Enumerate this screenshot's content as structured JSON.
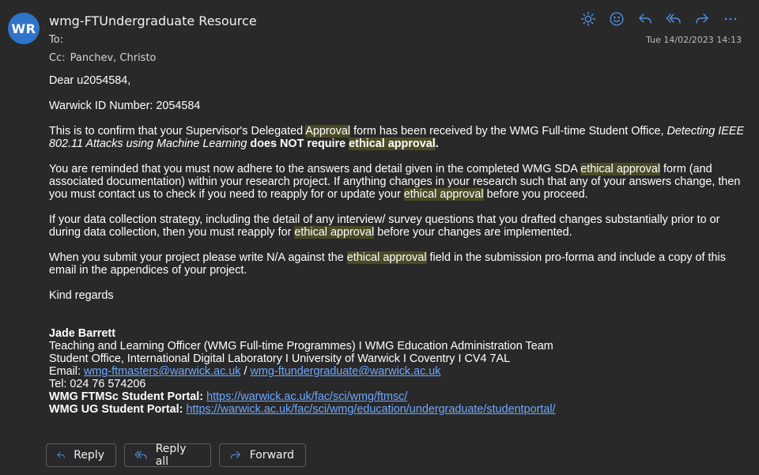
{
  "header": {
    "avatar_initials": "WR",
    "sender_name": "wmg-FTUndergraduate Resource",
    "to_label": "To:",
    "cc_label": "Cc:",
    "cc_name": "Panchev, Christo",
    "timestamp": "Tue 14/02/2023 14:13"
  },
  "toolbar": {
    "icons": [
      "brightness-icon",
      "emoji-icon",
      "reply-icon",
      "reply-all-icon",
      "forward-icon",
      "more-icon"
    ],
    "accent": "#4f8fe3"
  },
  "body": {
    "greeting": "Dear  u2054584,",
    "warwick_id": "Warwick ID Number: 2054584",
    "p1_a": "This is to confirm that your Supervisor's Delegated ",
    "p1_hl": "Approval",
    "p1_b": " form has been received by the WMG Full-time Student Office, ",
    "p1_title": "Detecting IEEE 802.11 Attacks using Machine Learning",
    "p1_c": " does NOT require ",
    "p1_hl2": "ethical approval",
    "p1_d": ".",
    "p2_a": "You are reminded that you must now adhere to the answers and detail given in the completed WMG SDA ",
    "p2_hl": "ethical approval",
    "p2_b": " form (and associated documentation) within your research project. If anything changes in your research such that any of your answers change, then you must contact us to check if you need to reapply for or update your ",
    "p2_hl2": "ethical approval",
    "p2_c": " before you proceed.",
    "p3_a": "If your data collection strategy, including the detail of any interview/ survey questions that you drafted changes substantially prior to or during data collection, then you must reapply for ",
    "p3_hl": "ethical approval",
    "p3_b": " before your changes are implemented.",
    "p4_a": "When you submit your project please write N/A against the ",
    "p4_hl": "ethical approval",
    "p4_b": " field in the submission pro-forma and include a copy of this email in the appendices of your project.",
    "closing": "Kind regards"
  },
  "signature": {
    "name": "Jade Barrett",
    "role": "Teaching and Learning Officer (WMG Full-time Programmes) I WMG Education Administration Team",
    "address": "Student Office, International Digital Laboratory I University of Warwick I Coventry I CV4 7AL",
    "email_label": "Email: ",
    "email1": "wmg-ftmasters@warwick.ac.uk",
    "email_sep": " / ",
    "email2": "wmg-ftundergraduate@warwick.ac.uk",
    "tel": "Tel: 024 76 574206",
    "portal1_label": "WMG FTMSc Student Portal:",
    "portal1_url": "https://warwick.ac.uk/fac/sci/wmg/ftmsc/",
    "portal2_label": "WMG UG Student Portal:",
    "portal2_url": "https://warwick.ac.uk/fac/sci/wmg/education/undergraduate/studentportal/"
  },
  "actions": {
    "reply_label": "Reply",
    "reply_all_label": "Reply all",
    "forward_label": "Forward"
  }
}
